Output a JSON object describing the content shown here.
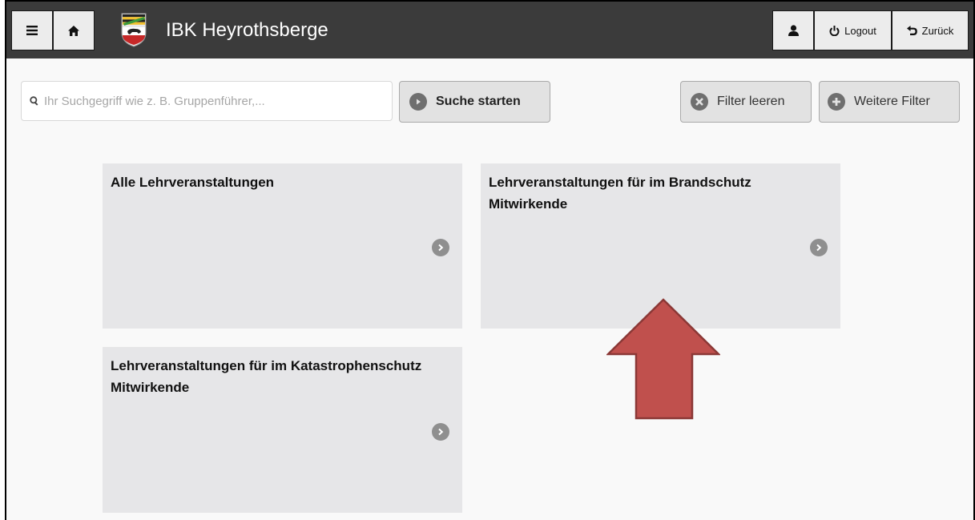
{
  "header": {
    "title": "IBK Heyrothsberge",
    "logout_label": "Logout",
    "back_label": "Zurück",
    "logo_icon": "coat-of-arms-logo",
    "menu_icon": "hamburger-menu-icon",
    "home_icon": "home-icon",
    "user_icon": "user-icon",
    "logout_icon": "power-icon",
    "back_icon": "undo-arrow-icon"
  },
  "search": {
    "placeholder": "Ihr Suchgegriff wie z. B. Gruppenführer,...",
    "value": "",
    "submit_label": "Suche starten",
    "clear_filter_label": "Filter leeren",
    "more_filter_label": "Weitere Filter"
  },
  "tiles": [
    {
      "title": "Alle Lehrveranstaltungen"
    },
    {
      "title": "Lehrveranstaltungen für im Brandschutz Mitwirkende"
    },
    {
      "title": "Lehrveranstaltungen für im Katastrophenschutz Mitwirkende"
    }
  ],
  "colors": {
    "header_bg": "#3b3b3b",
    "tile_bg": "#e6e6e8",
    "arrow_fill": "#c0504d",
    "arrow_stroke": "#8b3836"
  }
}
